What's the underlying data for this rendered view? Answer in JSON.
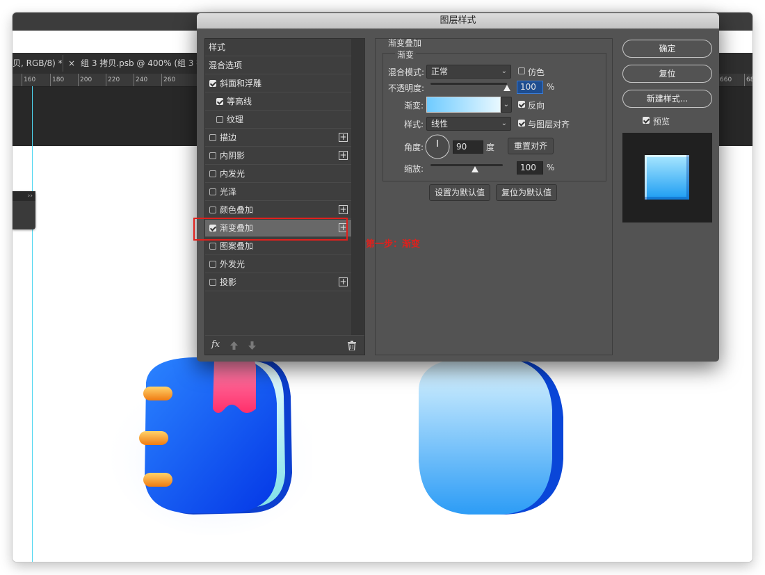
{
  "document_tabs": [
    {
      "label": "贝, RGB/8) *"
    },
    {
      "label": "×"
    },
    {
      "label": "组 3 拷贝.psb @ 400% (组 3 拷"
    }
  ],
  "ruler": {
    "left_ticks": [
      "160",
      "180",
      "200",
      "220",
      "240",
      "260"
    ],
    "right_ticks": [
      "660",
      "68"
    ]
  },
  "side_panel": {
    "handle": "››"
  },
  "dialog": {
    "title": "图层样式",
    "style_list": [
      {
        "label": "样式"
      },
      {
        "label": "混合选项"
      },
      {
        "label": "斜面和浮雕",
        "checked": true
      },
      {
        "label": "等高线",
        "checked": true
      },
      {
        "label": "纹理",
        "checked": false
      },
      {
        "label": "描边",
        "checked": false,
        "plus": "+"
      },
      {
        "label": "内阴影",
        "checked": false,
        "plus": "+"
      },
      {
        "label": "内发光",
        "checked": false
      },
      {
        "label": "光泽",
        "checked": false
      },
      {
        "label": "颜色叠加",
        "checked": false,
        "plus": "+"
      },
      {
        "label": "渐变叠加",
        "checked": true,
        "plus": "+"
      },
      {
        "label": "图案叠加",
        "checked": false
      },
      {
        "label": "外发光",
        "checked": false
      },
      {
        "label": "投影",
        "checked": false,
        "plus": "+"
      }
    ],
    "footer": {
      "fx": "fx"
    },
    "gradient_overlay": {
      "section_title": "渐变叠加",
      "subsection_title": "渐变",
      "blend_mode_label": "混合模式:",
      "blend_mode_value": "正常",
      "dither_label": "仿色",
      "opacity_label": "不透明度:",
      "opacity_value": "100",
      "opacity_unit": "%",
      "opacity_level": 1.0,
      "gradient_label": "渐变:",
      "reverse_label": "反向",
      "style_label": "样式:",
      "style_value": "线性",
      "align_label": "与图层对齐",
      "angle_label": "角度:",
      "angle_value": "90",
      "angle_unit": "度",
      "reset_align_button": "重置对齐",
      "scale_label": "缩放:",
      "scale_value": "100",
      "scale_unit": "%",
      "scale_level": 0.62,
      "set_default_button": "设置为默认值",
      "reset_default_button": "复位为默认值"
    },
    "ok_button": "确定",
    "reset_button": "复位",
    "new_style_button": "新建样式...",
    "preview_label": "预览"
  },
  "annotation": "第一步：渐变",
  "colors": {
    "accent_red": "#e0201c",
    "guide": "#4fd6f0",
    "gradient_top": "#a9e7ff",
    "gradient_bottom": "#1b9cf2"
  }
}
